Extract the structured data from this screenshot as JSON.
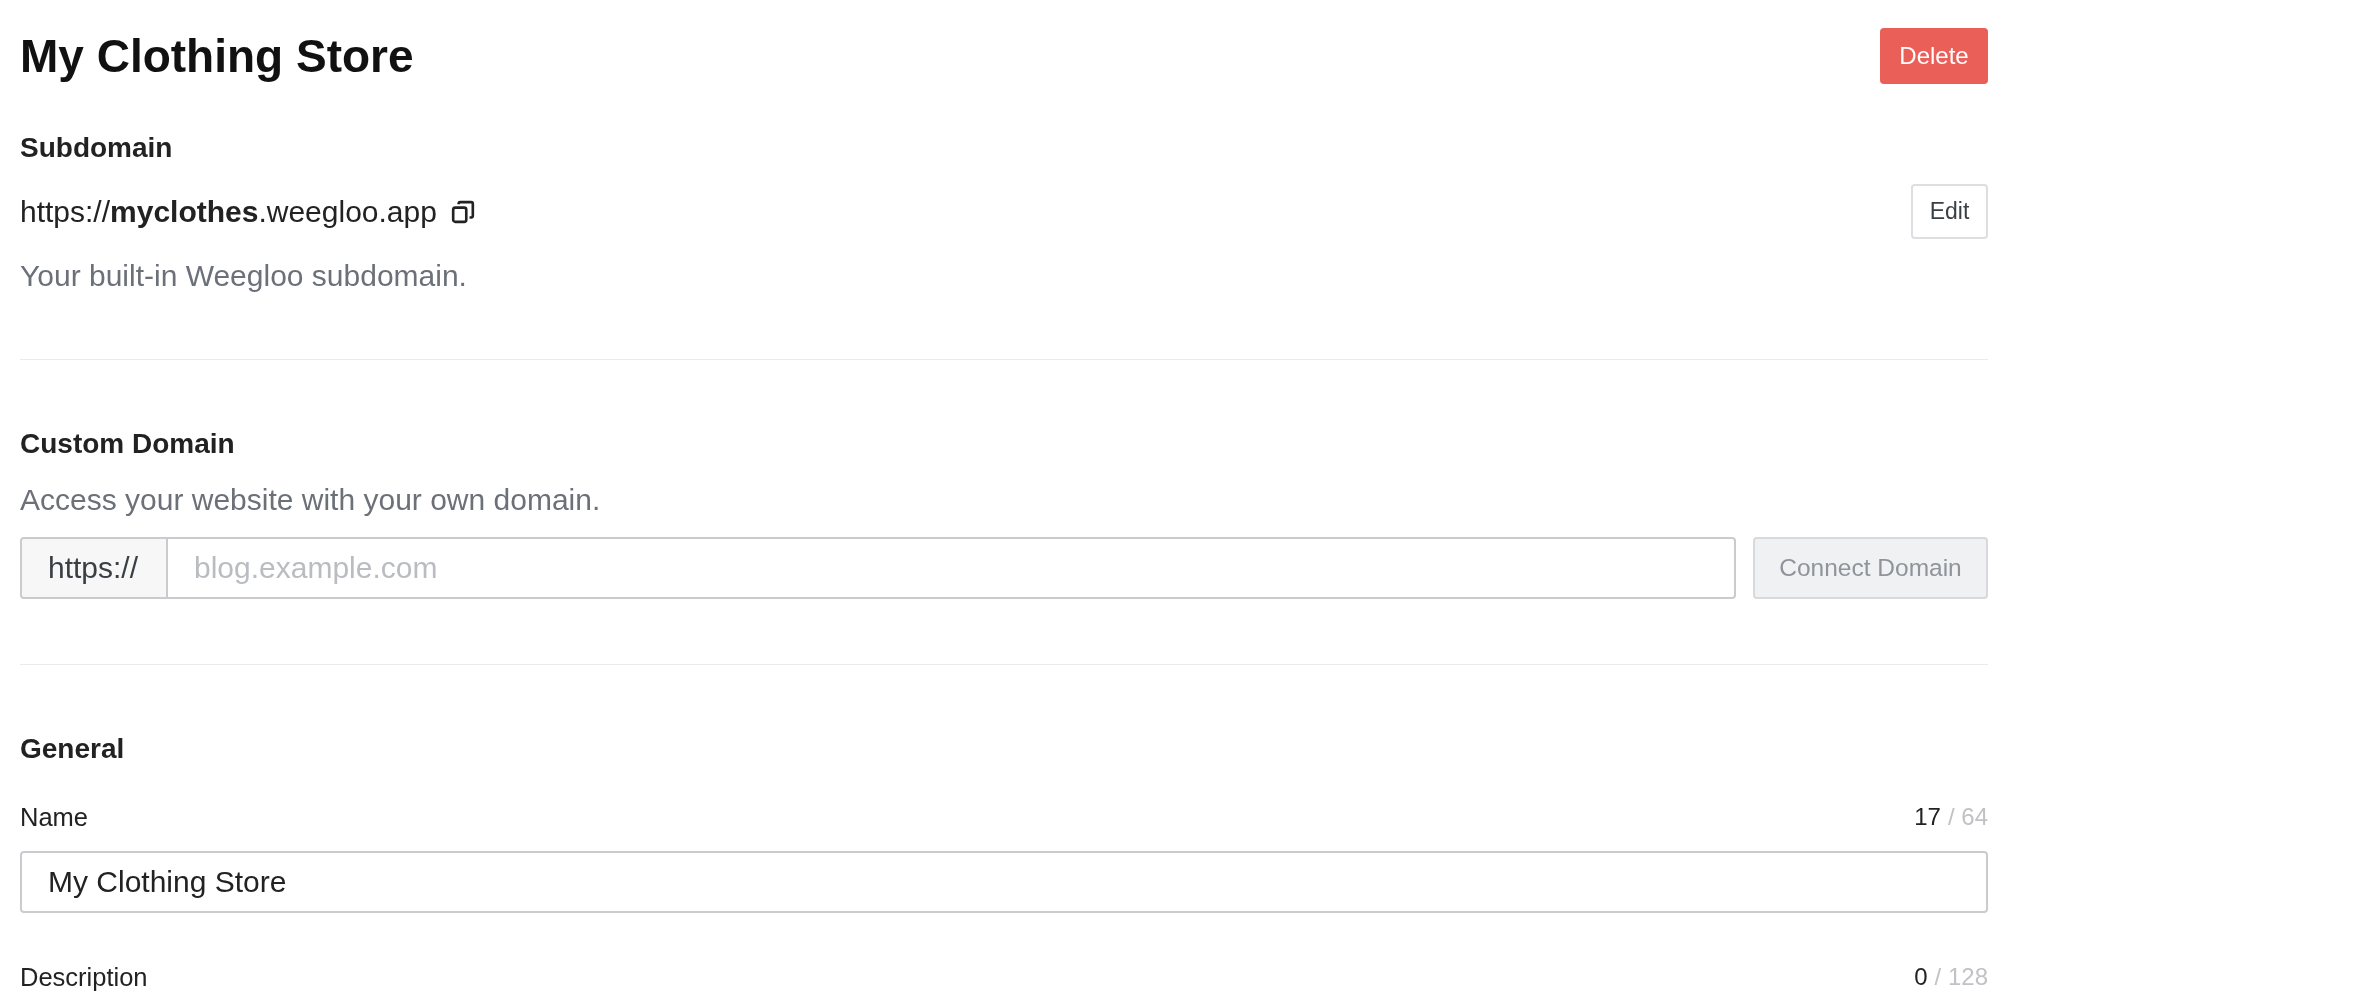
{
  "header": {
    "title": "My Clothing Store",
    "delete_button": "Delete"
  },
  "sections": [
    {
      "kind": "subdomain",
      "heading": "Subdomain",
      "url": "https://**myclothes**.weegloo.app",
      "edit_button": "Edit",
      "help": "Your built-in Weegloo subdomain."
    },
    {
      "kind": "custom_domain",
      "heading": "Custom Domain",
      "help": "Access your website with your own domain.",
      "prefix": "https://",
      "placeholder": "blog.example.com",
      "connect_button": {
        "label": "Connect Domain",
        "disabled": true
      }
    },
    {
      "kind": "general",
      "heading": "General",
      "fields": [
        {
          "label": "Name",
          "count": "17",
          "limit": "/ 64",
          "value": "My Clothing Store"
        },
        {
          "label": "Description",
          "count": "0",
          "limit": "/ 128"
        }
      ]
    }
  ]
}
